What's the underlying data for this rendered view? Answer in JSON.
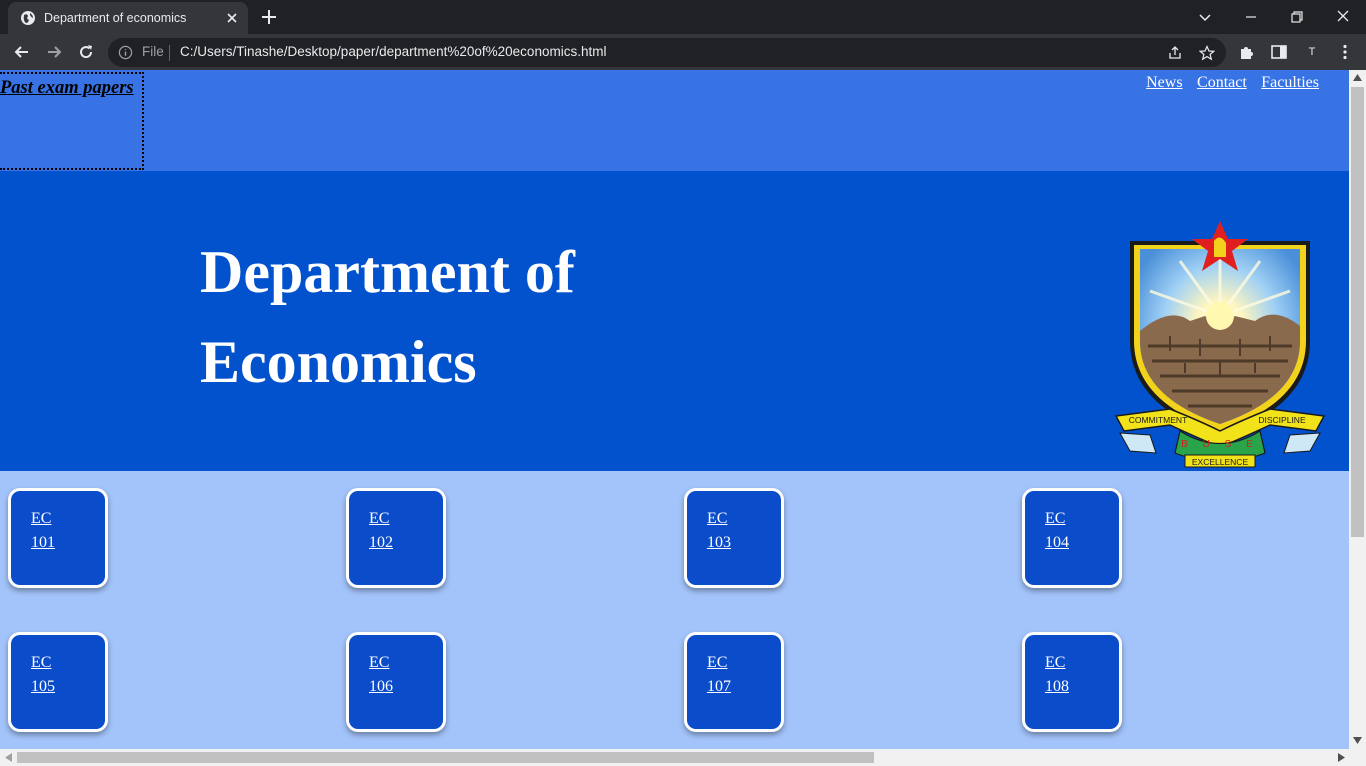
{
  "browser": {
    "tab_title": "Department of economics",
    "address_scheme": "File",
    "address_url": "C:/Users/Tinashe/Desktop/paper/department%20of%20economics.html",
    "profile_initial": "T"
  },
  "page": {
    "past_exam_link": "Past exam papers",
    "nav_links": [
      "News",
      "Contact",
      "Faculties"
    ],
    "hero_title": "Department of Economics",
    "crest": {
      "motto_left": "COMMITMENT",
      "motto_right": "DISCIPLINE",
      "letters": "B U S E",
      "motto_bottom": "EXCELLENCE"
    },
    "courses": [
      {
        "line1": "EC",
        "line2": "101"
      },
      {
        "line1": "EC",
        "line2": "102"
      },
      {
        "line1": "EC",
        "line2": "103"
      },
      {
        "line1": "EC",
        "line2": "104"
      },
      {
        "line1": "EC",
        "line2": "105"
      },
      {
        "line1": "EC",
        "line2": "106"
      },
      {
        "line1": "EC",
        "line2": "107"
      },
      {
        "line1": "EC",
        "line2": "108"
      }
    ]
  },
  "colors": {
    "nav_bg": "#3873e5",
    "hero_bg": "#0251cd",
    "content_bg": "#a3c4fb",
    "card_bg": "#0b4ccb"
  }
}
